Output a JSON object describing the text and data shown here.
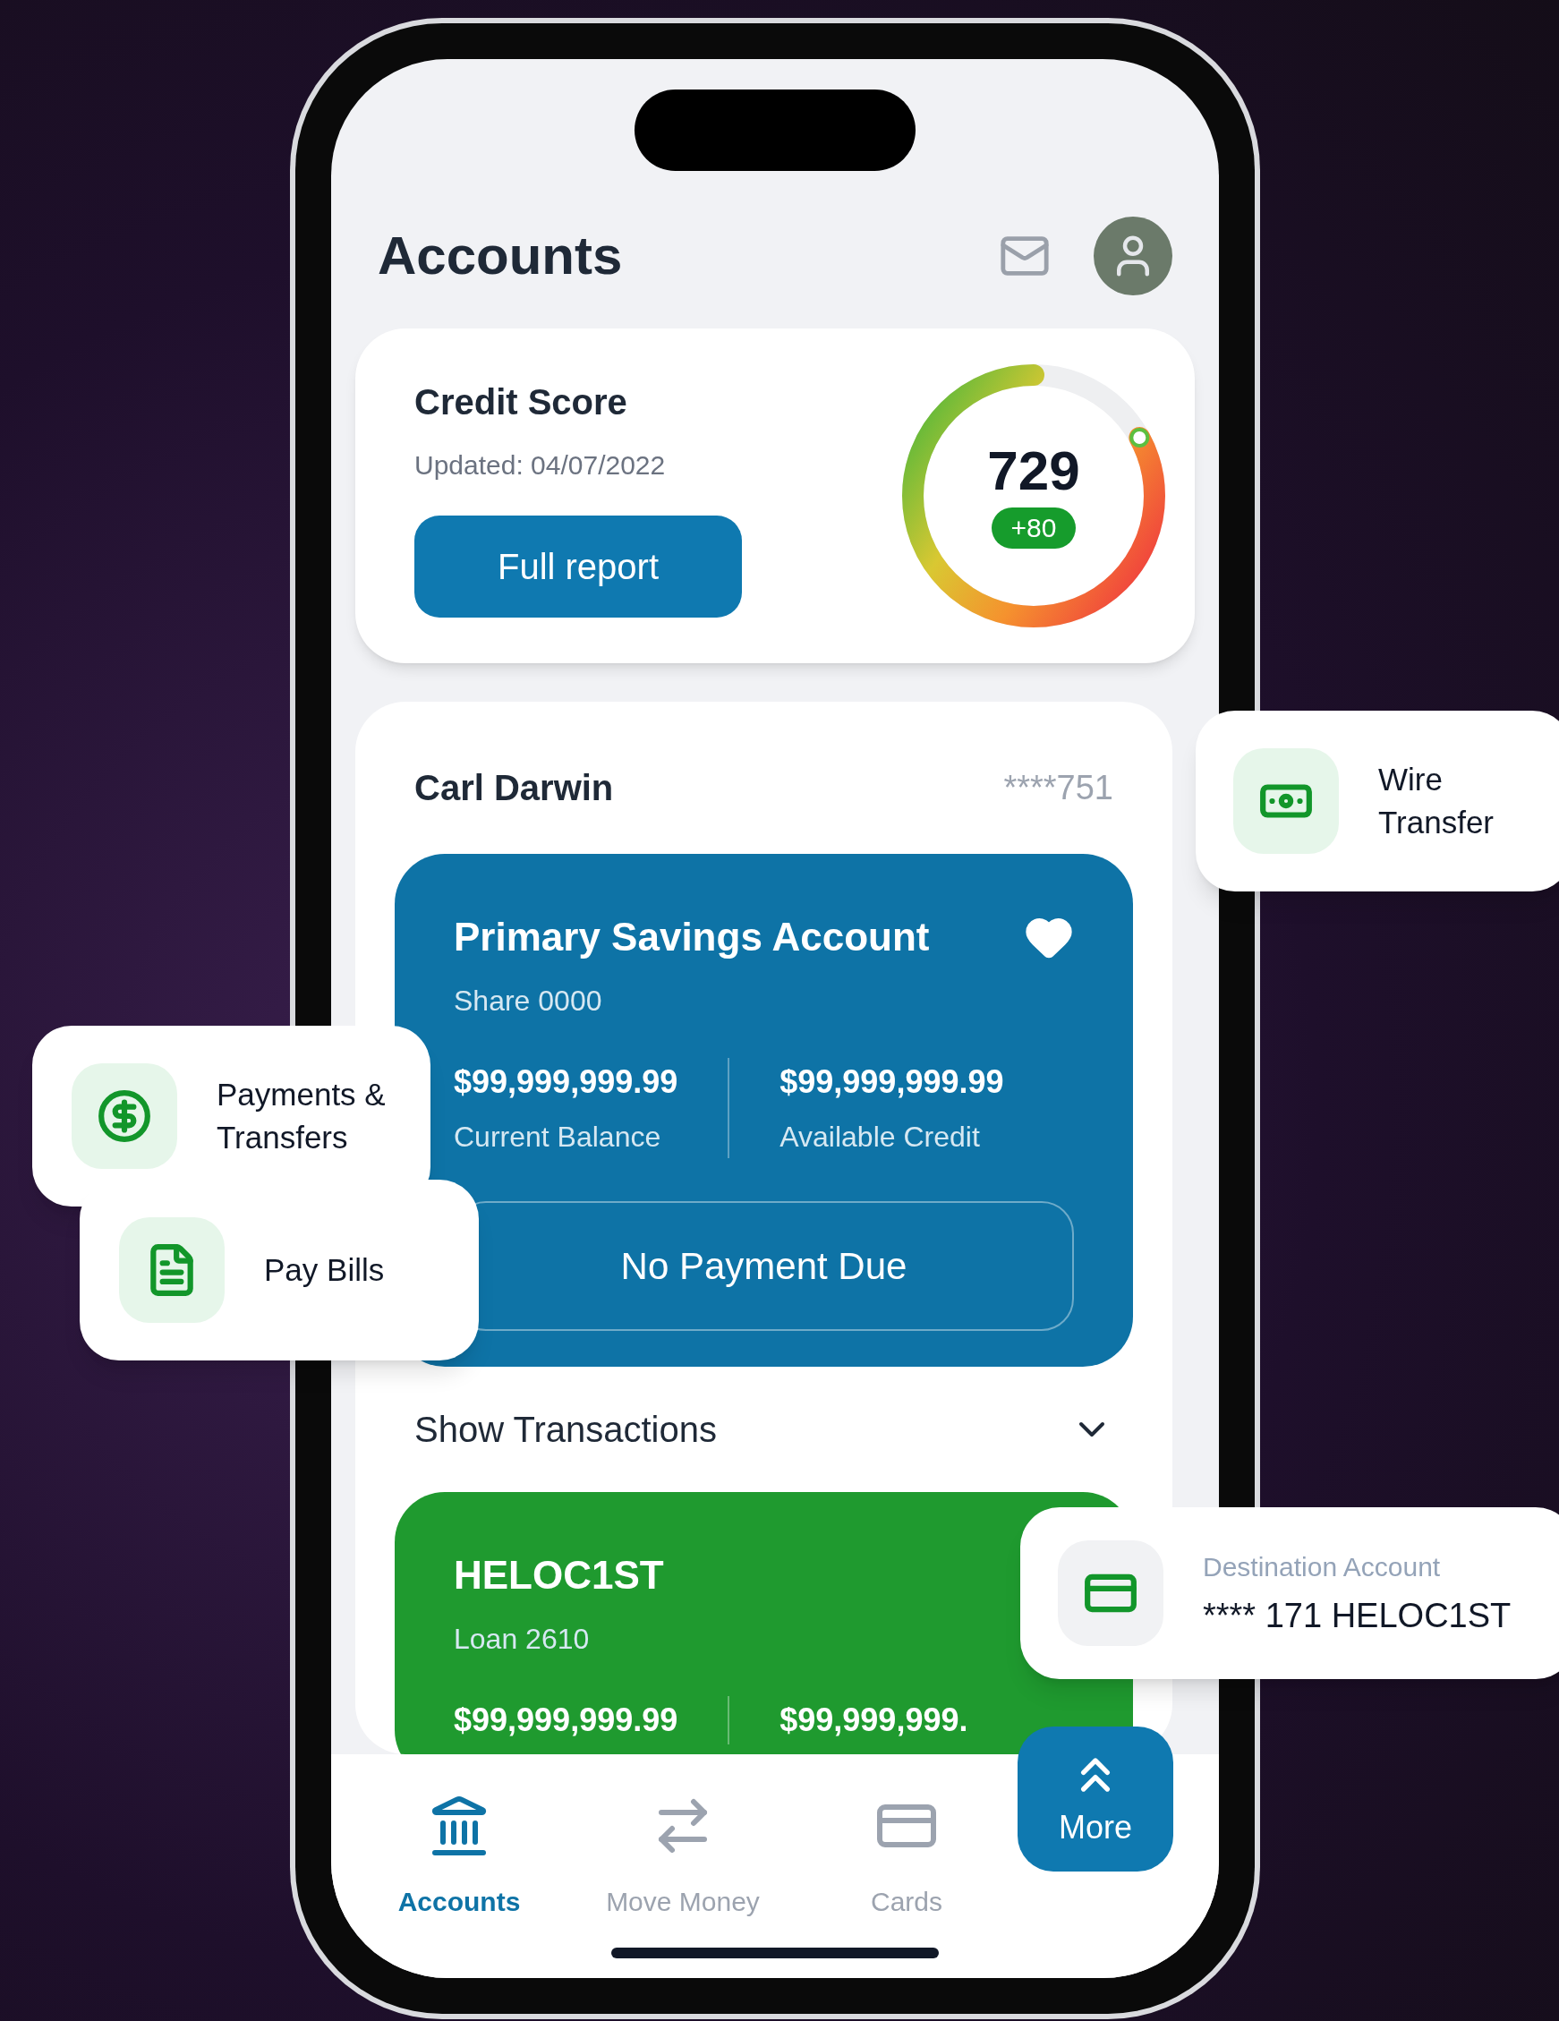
{
  "header": {
    "title": "Accounts"
  },
  "credit_score": {
    "title": "Credit Score",
    "updated": "Updated: 04/07/2022",
    "button": "Full report",
    "score": "729",
    "change": "+80",
    "level": 0.83
  },
  "account_holder": {
    "name": "Carl Darwin",
    "number": "****751"
  },
  "accounts": [
    {
      "kind": "savings",
      "title": "Primary Savings Account",
      "subtitle": "Share 0000",
      "favorite": true,
      "balances": [
        {
          "amount": "$99,999,999.99",
          "label": "Current Balance"
        },
        {
          "amount": "$99,999,999.99",
          "label": "Available Credit"
        }
      ],
      "status": "No Payment Due"
    },
    {
      "kind": "loan",
      "title": "HELOC1ST",
      "subtitle": "Loan 2610",
      "balances": [
        {
          "amount": "$99,999,999.99"
        },
        {
          "amount": "$99,999,999."
        }
      ]
    }
  ],
  "show_transactions": {
    "label": "Show Transactions",
    "expanded": false
  },
  "nav": {
    "tabs": [
      {
        "kind": "accounts",
        "label": "Accounts",
        "selected": true
      },
      {
        "kind": "move",
        "label": "Move Money",
        "selected": false
      },
      {
        "kind": "cards",
        "label": "Cards",
        "selected": false
      }
    ],
    "more": "More"
  },
  "floating_cards": [
    {
      "kind": "wire",
      "label": "Wire Transfer"
    },
    {
      "kind": "payments",
      "label": "Payments & Transfers"
    },
    {
      "kind": "bills",
      "label": "Pay Bills"
    },
    {
      "kind": "destination",
      "caption": "Destination Account",
      "label": "**** 171 HELOC1ST"
    }
  ]
}
